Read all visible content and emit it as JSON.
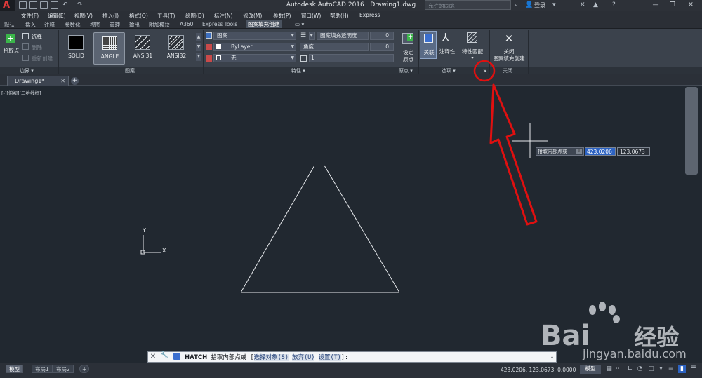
{
  "window": {
    "app_title": "Autodesk AutoCAD 2016",
    "file_name": "Drawing1.dwg",
    "search_placeholder": "允许的同眺",
    "login": "登录"
  },
  "menubar": {
    "items": [
      "文件(F)",
      "编辑(E)",
      "视图(V)",
      "插入(I)",
      "格式(O)",
      "工具(T)",
      "绘图(D)",
      "标注(N)",
      "修改(M)",
      "参数(P)",
      "窗口(W)",
      "帮助(H)",
      "Express"
    ]
  },
  "ribbon_tabs": {
    "items": [
      "默认",
      "插入",
      "注释",
      "参数化",
      "视图",
      "管理",
      "输出",
      "附加模块",
      "A360",
      "Express Tools",
      "图案填充创建"
    ],
    "active": "图案填充创建"
  },
  "ribbon": {
    "boundary": {
      "pick_points": "拾取点",
      "select": "选择",
      "remove": "删除",
      "recreate": "重新创建",
      "panel_title": "边界 ▾"
    },
    "pattern": {
      "tiles": [
        "SOLID",
        "ANGLE",
        "ANSI31",
        "ANSI32"
      ],
      "selected": "ANGLE",
      "panel_title": "图案"
    },
    "properties": {
      "hatch_type": "图案",
      "color": "ByLayer",
      "background": "无",
      "transparency_label": "图案填充透明度",
      "transparency_value": "0",
      "angle_label": "角度",
      "angle_value": "0",
      "scale_value": "1",
      "panel_title": "特性 ▾"
    },
    "origin": {
      "set_origin_line1": "设定",
      "set_origin_line2": "原点",
      "panel_title": "原点 ▾"
    },
    "options": {
      "associative": "关联",
      "annotative": "注释性",
      "match_properties": "特性匹配",
      "panel_title": "选项 ▾",
      "dialog_launcher": "↘"
    },
    "close": {
      "line1": "关闭",
      "line2": "图案填充创建",
      "panel_title": "关闭"
    }
  },
  "document": {
    "tab_name": "Drawing1*",
    "viewport_label": "[-][俯视][二维线框]"
  },
  "canvas": {
    "ucs_x": "X",
    "ucs_y": "Y",
    "tooltip_prompt": "拾取内部点或",
    "coord_x": "423.0206",
    "coord_y": "123.0673"
  },
  "command_line": {
    "command": "HATCH",
    "prompt": "拾取内部点或",
    "open_bracket": "[",
    "option_select": "选择对象(S)",
    "option_undo": "放弃(U)",
    "option_settings": "设置(T)",
    "close_bracket": "]:"
  },
  "statusbar": {
    "layout_tabs": [
      "模型",
      "布局1",
      "布局2"
    ],
    "active_layout": "模型",
    "coordinates": "423.0206, 123.0673, 0.0000",
    "mode": "模型"
  },
  "watermark": {
    "brand": "Bai",
    "brand_suffix": "经验",
    "url": "jingyan.baidu.com"
  },
  "colors": {
    "canvas_bg": "#212830",
    "ribbon_bg": "#3b424c",
    "annotation_red": "#e01010",
    "highlight_blue": "#2d63c2"
  }
}
